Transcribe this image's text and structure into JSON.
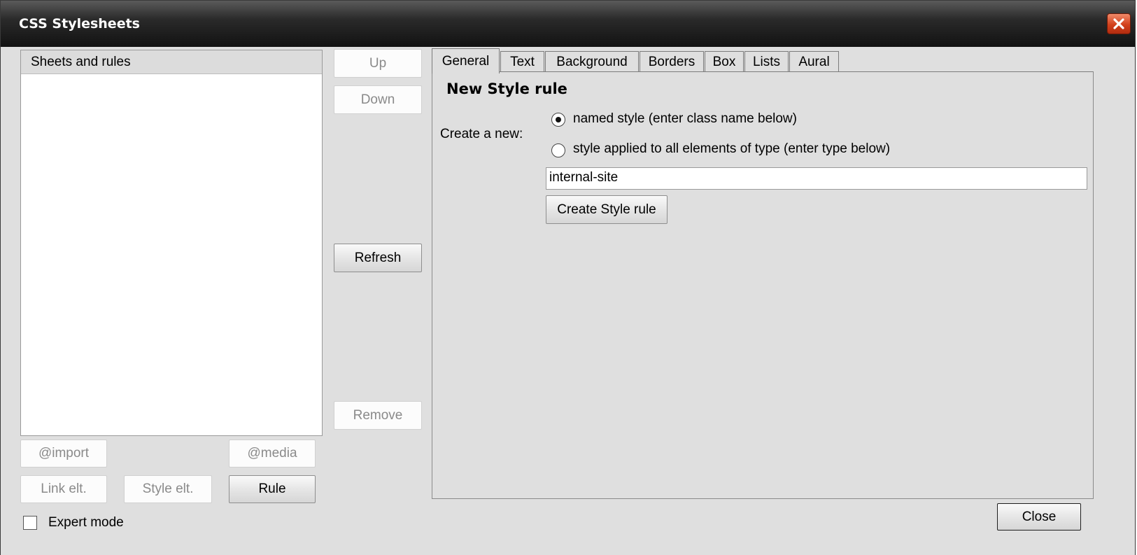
{
  "window": {
    "title": "CSS Stylesheets",
    "close_icon": "close-icon"
  },
  "left": {
    "list_header": "Sheets and rules",
    "buttons": {
      "import": "@import",
      "media": "@media",
      "link_elt": "Link elt.",
      "style_elt": "Style elt.",
      "rule": "Rule"
    },
    "expert_mode": "Expert mode"
  },
  "middle": {
    "up": "Up",
    "down": "Down",
    "refresh": "Refresh",
    "remove": "Remove"
  },
  "tabs": [
    "General",
    "Text",
    "Background",
    "Borders",
    "Box",
    "Lists",
    "Aural"
  ],
  "active_tab": "General",
  "general": {
    "heading": "New Style rule",
    "create_label": "Create a new:",
    "option_named": "named style (enter class name below)",
    "option_type": "style applied to all elements of type (enter type below)",
    "selected_option": "named",
    "name_value": "internal-site",
    "create_button": "Create Style rule"
  },
  "footer": {
    "close": "Close"
  }
}
